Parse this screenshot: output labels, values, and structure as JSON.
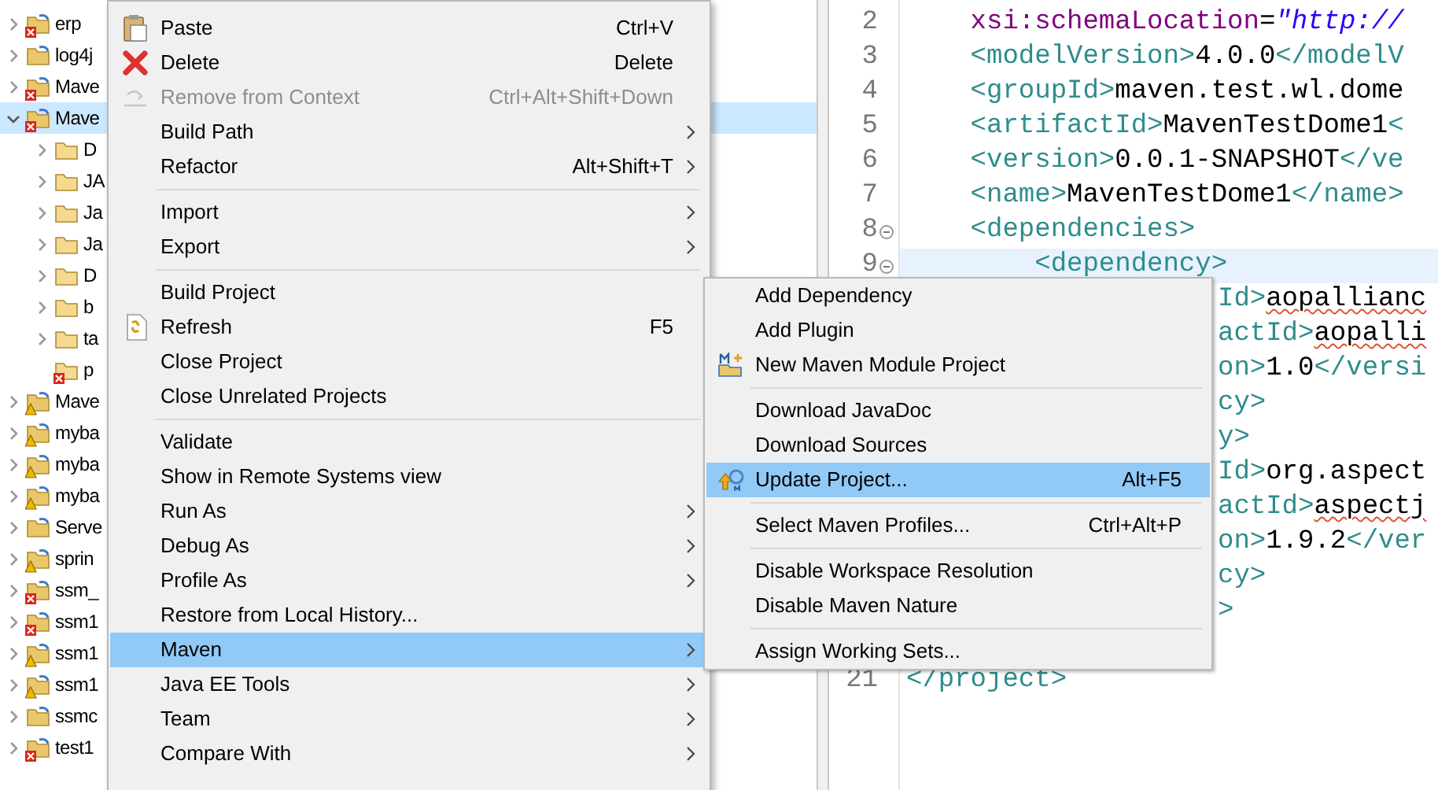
{
  "project_tree": {
    "items": [
      {
        "label": "erp",
        "expanded": false,
        "selected": false,
        "error": true,
        "warning": false
      },
      {
        "label": "log4j",
        "expanded": false,
        "selected": false,
        "error": false,
        "warning": false
      },
      {
        "label": "Mave",
        "expanded": false,
        "selected": false,
        "error": true,
        "warning": false
      },
      {
        "label": "Mave",
        "expanded": true,
        "selected": true,
        "error": true,
        "warning": false,
        "children": [
          {
            "label": "D",
            "expanded": false,
            "selected": false,
            "error": false,
            "warning": false
          },
          {
            "label": "JA",
            "expanded": false,
            "selected": false,
            "error": false,
            "warning": false
          },
          {
            "label": "Ja",
            "expanded": false,
            "selected": false,
            "error": false,
            "warning": false
          },
          {
            "label": "Ja",
            "expanded": false,
            "selected": false,
            "error": false,
            "warning": false
          },
          {
            "label": "D",
            "expanded": false,
            "selected": false,
            "error": false,
            "warning": false
          },
          {
            "label": "b",
            "expanded": false,
            "selected": false,
            "error": false,
            "warning": false
          },
          {
            "label": "ta",
            "expanded": false,
            "selected": false,
            "error": false,
            "warning": false
          },
          {
            "label": "p",
            "selected": false,
            "error": true,
            "warning": false
          }
        ]
      },
      {
        "label": "Mave",
        "expanded": false,
        "selected": false,
        "error": false,
        "warning": true
      },
      {
        "label": "myba",
        "expanded": false,
        "selected": false,
        "error": false,
        "warning": true
      },
      {
        "label": "myba",
        "expanded": false,
        "selected": false,
        "error": false,
        "warning": true
      },
      {
        "label": "myba",
        "expanded": false,
        "selected": false,
        "error": false,
        "warning": true
      },
      {
        "label": "Serve",
        "expanded": false,
        "selected": false,
        "error": false,
        "warning": false
      },
      {
        "label": "sprin",
        "expanded": false,
        "selected": false,
        "error": false,
        "warning": true
      },
      {
        "label": "ssm_",
        "expanded": false,
        "selected": false,
        "error": true,
        "warning": false
      },
      {
        "label": "ssm1",
        "expanded": false,
        "selected": false,
        "error": true,
        "warning": false
      },
      {
        "label": "ssm1",
        "expanded": false,
        "selected": false,
        "error": false,
        "warning": true
      },
      {
        "label": "ssm1",
        "expanded": false,
        "selected": false,
        "error": false,
        "warning": true
      },
      {
        "label": "ssmc",
        "expanded": false,
        "selected": false,
        "error": false,
        "warning": false
      },
      {
        "label": "test1",
        "expanded": false,
        "selected": false,
        "error": true,
        "warning": false
      }
    ]
  },
  "editor": {
    "lines": [
      {
        "kind": "full",
        "number": "2",
        "current": false,
        "foldable": false,
        "segments": [
          {
            "kind": "attr",
            "text": "    xsi:schemaLocation"
          },
          {
            "kind": "text",
            "text": "="
          },
          {
            "kind": "string",
            "text": "\"http://"
          }
        ]
      },
      {
        "kind": "full",
        "number": "3",
        "current": false,
        "foldable": false,
        "segments": [
          {
            "kind": "tag",
            "text": "    <modelVersion>"
          },
          {
            "kind": "text",
            "text": "4.0.0"
          },
          {
            "kind": "tag",
            "text": "</modelV"
          }
        ]
      },
      {
        "kind": "full",
        "number": "4",
        "current": false,
        "foldable": false,
        "segments": [
          {
            "kind": "tag",
            "text": "    <groupId>"
          },
          {
            "kind": "text",
            "text": "maven.test.wl.dome"
          }
        ]
      },
      {
        "kind": "full",
        "number": "5",
        "current": false,
        "foldable": false,
        "segments": [
          {
            "kind": "tag",
            "text": "    <artifactId>"
          },
          {
            "kind": "text",
            "text": "MavenTestDome1"
          },
          {
            "kind": "tag",
            "text": "<"
          }
        ]
      },
      {
        "kind": "full",
        "number": "6",
        "current": false,
        "foldable": false,
        "segments": [
          {
            "kind": "tag",
            "text": "    <version>"
          },
          {
            "kind": "text",
            "text": "0.0.1-SNAPSHOT"
          },
          {
            "kind": "tag",
            "text": "</ve"
          }
        ]
      },
      {
        "kind": "full",
        "number": "7",
        "current": false,
        "foldable": false,
        "segments": [
          {
            "kind": "tag",
            "text": "    <name>"
          },
          {
            "kind": "text",
            "text": "MavenTestDome1"
          },
          {
            "kind": "tag",
            "text": "</name>"
          }
        ]
      },
      {
        "kind": "full",
        "number": "8",
        "current": false,
        "foldable": true,
        "segments": [
          {
            "kind": "tag",
            "text": "    <dependencies>"
          }
        ]
      },
      {
        "kind": "full",
        "number": "9",
        "current": true,
        "foldable": true,
        "segments": [
          {
            "kind": "tag",
            "text": "        <dependency>"
          }
        ]
      },
      {
        "kind": "partial",
        "current": false,
        "segments": [
          {
            "kind": "tag",
            "text": "Id>"
          },
          {
            "kind": "misspelled",
            "text": "aopallianc"
          }
        ]
      },
      {
        "kind": "partial",
        "current": false,
        "segments": [
          {
            "kind": "tag",
            "text": "actId>"
          },
          {
            "kind": "misspelled",
            "text": "aopalli"
          }
        ]
      },
      {
        "kind": "partial",
        "current": false,
        "segments": [
          {
            "kind": "tag",
            "text": "on>"
          },
          {
            "kind": "text",
            "text": "1.0"
          },
          {
            "kind": "tag",
            "text": "</versi"
          }
        ]
      },
      {
        "kind": "partial",
        "current": false,
        "segments": [
          {
            "kind": "tag",
            "text": "cy>"
          }
        ]
      },
      {
        "kind": "partial",
        "current": false,
        "segments": [
          {
            "kind": "tag",
            "text": "y>"
          }
        ]
      },
      {
        "kind": "partial",
        "current": false,
        "segments": [
          {
            "kind": "tag",
            "text": "Id>"
          },
          {
            "kind": "text",
            "text": "org.aspect"
          }
        ]
      },
      {
        "kind": "partial",
        "current": false,
        "segments": [
          {
            "kind": "tag",
            "text": "actId>"
          },
          {
            "kind": "misspelled",
            "text": "aspectj"
          }
        ]
      },
      {
        "kind": "partial",
        "current": false,
        "segments": [
          {
            "kind": "tag",
            "text": "on>"
          },
          {
            "kind": "text",
            "text": "1.9.2"
          },
          {
            "kind": "tag",
            "text": "</ver"
          }
        ]
      },
      {
        "kind": "partial",
        "current": false,
        "segments": [
          {
            "kind": "tag",
            "text": "cy>"
          }
        ]
      },
      {
        "kind": "partial",
        "current": false,
        "segments": [
          {
            "kind": "tag",
            "text": ">"
          }
        ]
      },
      {
        "kind": "blank"
      },
      {
        "kind": "full",
        "number": "21",
        "current": false,
        "foldable": false,
        "segments": [
          {
            "kind": "tag",
            "text": "</project>"
          }
        ]
      }
    ]
  },
  "context_menu": {
    "items": [
      {
        "kind": "item",
        "label": "Paste",
        "shortcut": "Ctrl+V",
        "submenu": false,
        "disabled": false,
        "selected": false
      },
      {
        "kind": "item",
        "label": "Delete",
        "shortcut": "Delete",
        "submenu": false,
        "disabled": false,
        "selected": false
      },
      {
        "kind": "item",
        "label": "Remove from Context",
        "shortcut": "Ctrl+Alt+Shift+Down",
        "submenu": false,
        "disabled": true,
        "selected": false
      },
      {
        "kind": "item",
        "label": "Build Path",
        "submenu": true,
        "disabled": false,
        "selected": false
      },
      {
        "kind": "item",
        "label": "Refactor",
        "shortcut": "Alt+Shift+T",
        "submenu": true,
        "disabled": false,
        "selected": false
      },
      {
        "kind": "separator"
      },
      {
        "kind": "item",
        "label": "Import",
        "submenu": true,
        "disabled": false,
        "selected": false
      },
      {
        "kind": "item",
        "label": "Export",
        "submenu": true,
        "disabled": false,
        "selected": false
      },
      {
        "kind": "separator"
      },
      {
        "kind": "item",
        "label": "Build Project",
        "submenu": false,
        "disabled": false,
        "selected": false
      },
      {
        "kind": "item",
        "label": "Refresh",
        "shortcut": "F5",
        "submenu": false,
        "disabled": false,
        "selected": false
      },
      {
        "kind": "item",
        "label": "Close Project",
        "submenu": false,
        "disabled": false,
        "selected": false
      },
      {
        "kind": "item",
        "label": "Close Unrelated Projects",
        "submenu": false,
        "disabled": false,
        "selected": false
      },
      {
        "kind": "separator"
      },
      {
        "kind": "item",
        "label": "Validate",
        "submenu": false,
        "disabled": false,
        "selected": false
      },
      {
        "kind": "item",
        "label": "Show in Remote Systems view",
        "submenu": false,
        "disabled": false,
        "selected": false
      },
      {
        "kind": "item",
        "label": "Run As",
        "submenu": true,
        "disabled": false,
        "selected": false
      },
      {
        "kind": "item",
        "label": "Debug As",
        "submenu": true,
        "disabled": false,
        "selected": false
      },
      {
        "kind": "item",
        "label": "Profile As",
        "submenu": true,
        "disabled": false,
        "selected": false
      },
      {
        "kind": "item",
        "label": "Restore from Local History...",
        "submenu": false,
        "disabled": false,
        "selected": false
      },
      {
        "kind": "item",
        "label": "Maven",
        "submenu": true,
        "disabled": false,
        "selected": true
      },
      {
        "kind": "item",
        "label": "Java EE Tools",
        "submenu": true,
        "disabled": false,
        "selected": false
      },
      {
        "kind": "item",
        "label": "Team",
        "submenu": true,
        "disabled": false,
        "selected": false
      },
      {
        "kind": "item",
        "label": "Compare With",
        "submenu": true,
        "disabled": false,
        "selected": false
      }
    ]
  },
  "maven_submenu": {
    "items": [
      {
        "kind": "item",
        "label": "Add Dependency",
        "selected": false
      },
      {
        "kind": "item",
        "label": "Add Plugin",
        "selected": false
      },
      {
        "kind": "item",
        "label": "New Maven Module Project",
        "selected": false
      },
      {
        "kind": "separator"
      },
      {
        "kind": "item",
        "label": "Download JavaDoc",
        "selected": false
      },
      {
        "kind": "item",
        "label": "Download Sources",
        "selected": false
      },
      {
        "kind": "item",
        "label": "Update Project...",
        "shortcut": "Alt+F5",
        "selected": true
      },
      {
        "kind": "separator"
      },
      {
        "kind": "item",
        "label": "Select Maven Profiles...",
        "shortcut": "Ctrl+Alt+P",
        "selected": false
      },
      {
        "kind": "separator"
      },
      {
        "kind": "item",
        "label": "Disable Workspace Resolution",
        "selected": false
      },
      {
        "kind": "item",
        "label": "Disable Maven Nature",
        "selected": false
      },
      {
        "kind": "separator"
      },
      {
        "kind": "item",
        "label": "Assign Working Sets...",
        "selected": false
      }
    ]
  }
}
